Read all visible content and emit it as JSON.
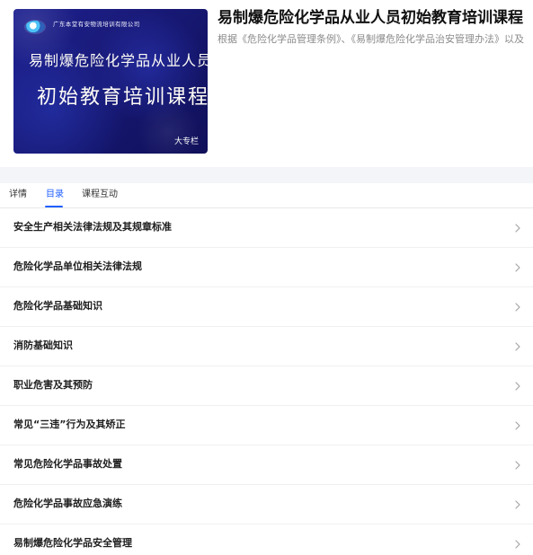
{
  "course": {
    "title": "易制爆危险化学品从业人员初始教育培训课程",
    "subtitle": "根据《危险化学品管理条例》、《易制爆危险化学品治安管理办法》以及",
    "cover": {
      "company": "广东本堂有安物流培训有限公司",
      "line1": "易制爆危险化学品从业人员",
      "line2": "初始教育培训课程",
      "badge": "大专栏"
    }
  },
  "tabs": {
    "detail": "详情",
    "catalog": "目录",
    "interaction": "课程互动"
  },
  "catalog": {
    "items": [
      {
        "label": "安全生产相关法律法规及其规章标准"
      },
      {
        "label": "危险化学品单位相关法律法规"
      },
      {
        "label": "危险化学品基础知识"
      },
      {
        "label": "消防基础知识"
      },
      {
        "label": "职业危害及其预防"
      },
      {
        "label": "常见“三违”行为及其矫正"
      },
      {
        "label": "常见危险化学品事故处置"
      },
      {
        "label": "危险化学品事故应急演练"
      },
      {
        "label": "易制爆危险化学品安全管理"
      }
    ]
  },
  "icons": {
    "item_arrow": "chevron-right-icon",
    "cover_logo": "logo-icon"
  },
  "colors": {
    "accent": "#1f5fff",
    "cover_primary": "#1a1b7b",
    "cover_secondary": "#10105a",
    "band": "#f3f5f9"
  }
}
